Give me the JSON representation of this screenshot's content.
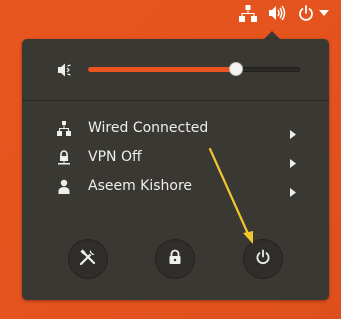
{
  "topbar": {
    "icons": [
      "network-wired-icon",
      "volume-icon",
      "power-icon",
      "dropdown-arrow-icon"
    ]
  },
  "volume": {
    "icon": "volume-muted-icon",
    "level": 0.7,
    "accent_color": "#e95420"
  },
  "menu": {
    "items": [
      {
        "label": "Wired Connected",
        "icon": "network-wired-icon"
      },
      {
        "label": "VPN Off",
        "icon": "vpn-icon"
      },
      {
        "label": "Aseem Kishore",
        "icon": "user-icon"
      }
    ]
  },
  "actions": {
    "buttons": [
      "settings-icon",
      "lock-icon",
      "power-icon"
    ]
  },
  "annotation": {
    "arrow_color": "#f2c42e"
  }
}
